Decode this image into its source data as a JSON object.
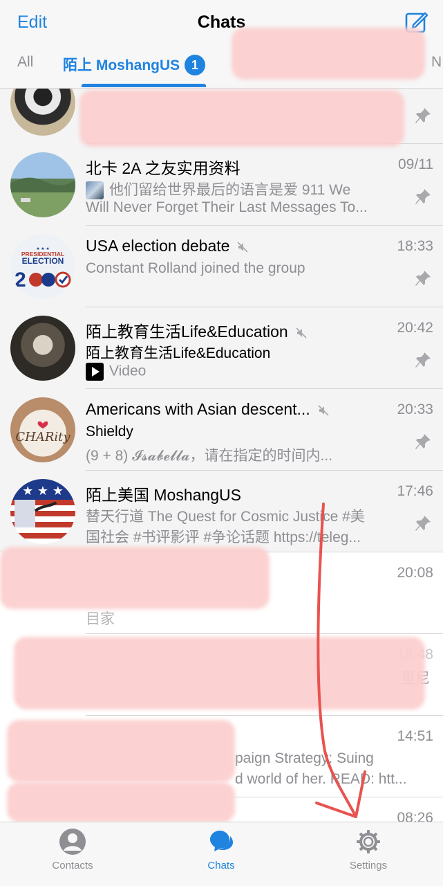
{
  "header": {
    "edit_label": "Edit",
    "title": "Chats",
    "compose_icon": "compose-icon"
  },
  "folder_tabs": {
    "all": "All",
    "moshang": "陌上 MoshangUS",
    "moshang_badge": "1",
    "partial_next": "N"
  },
  "chats": [
    {
      "name": "北卡 2A 之友实用资料",
      "time": "09/11",
      "line1": "他们留给世界最后的语言是爱 911 We",
      "line2": "Will Never Forget Their Last Messages To...",
      "pinned": true
    },
    {
      "name": "USA election debate",
      "time": "18:33",
      "line1": "Constant Rolland joined the group",
      "muted": true,
      "pinned": true,
      "avatar_text": {
        "top": "PRESIDENTIAL",
        "mid": "ELECTION"
      }
    },
    {
      "name": "陌上教育生活Life&Education",
      "time": "20:42",
      "sender": "陌上教育生活Life&Education",
      "line2": "Video",
      "muted": true,
      "pinned": true
    },
    {
      "name": "Americans with Asian descent...",
      "time": "20:33",
      "sender": "Shieldy",
      "line2": "(9 + 8) 𝓘𝓼𝓪𝓫𝓮𝓵𝓵𝓪，请在指定的时间内...",
      "muted": true,
      "pinned": true,
      "avatar_text": "CHARity"
    },
    {
      "name": "陌上美国 MoshangUS",
      "time": "17:46",
      "line1": "替天行道 The Quest for Cosmic Justice #美",
      "line2": "国社会 #书评影评 #争论话题 https://teleg...",
      "pinned": true
    }
  ],
  "redacted_rows": [
    {
      "time": "20:08",
      "line2": "目家"
    },
    {
      "time": "18:48",
      "line1": "里尼"
    },
    {
      "time": "14:51",
      "line1": "paign Strategy: Suing",
      "line2": "d world of her. READ: htt..."
    },
    {
      "time": "08:26"
    }
  ],
  "tabbar": {
    "contacts": "Contacts",
    "chats": "Chats",
    "settings": "Settings"
  },
  "colors": {
    "accent": "#1f83e0",
    "pinned_bg": "#f4f4f5",
    "annotation_arrow": "#e8534f"
  }
}
